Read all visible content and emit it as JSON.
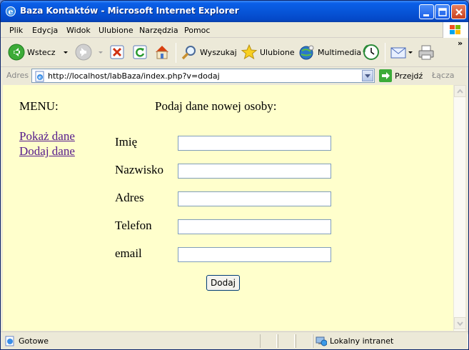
{
  "window": {
    "title": "Baza Kontaktów - Microsoft Internet Explorer"
  },
  "menubar": {
    "items": [
      "Plik",
      "Edycja",
      "Widok",
      "Ulubione",
      "Narzędzia",
      "Pomoc"
    ]
  },
  "toolbar": {
    "back_label": "Wstecz",
    "search_label": "Wyszukaj",
    "favorites_label": "Ulubione",
    "multimedia_label": "Multimedia",
    "overflow": "»"
  },
  "address": {
    "label": "Adres",
    "url": "http://localhost/labBaza/index.php?v=dodaj",
    "go_label": "Przejdź",
    "links_label": "Łącza"
  },
  "page": {
    "menu_title": "MENU:",
    "nav_links": [
      "Pokaż dane",
      "Dodaj dane"
    ],
    "form_title": "Podaj dane nowej osoby:",
    "fields": [
      {
        "label": "Imię",
        "value": ""
      },
      {
        "label": "Nazwisko",
        "value": ""
      },
      {
        "label": "Adres",
        "value": ""
      },
      {
        "label": "Telefon",
        "value": ""
      },
      {
        "label": "email",
        "value": ""
      }
    ],
    "submit_label": "Dodaj"
  },
  "status": {
    "text": "Gotowe",
    "zone": "Lokalny intranet"
  },
  "colors": {
    "page_background": "#ffffcc",
    "link_visited": "#551a8b",
    "titlebar_blue": "#0755d8"
  }
}
